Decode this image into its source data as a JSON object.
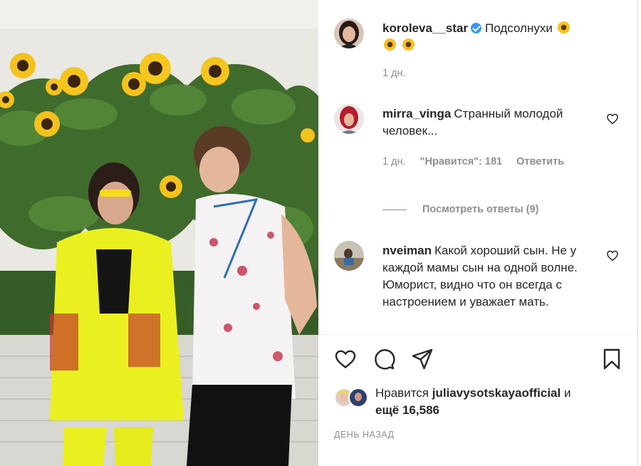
{
  "post": {
    "author": "koroleva__star",
    "caption": "Подсолнухи",
    "caption_emoji": [
      "sunflower-emoji",
      "sunflower-emoji",
      "sunflower-emoji"
    ],
    "time": "1 дн."
  },
  "comments": [
    {
      "username": "mirra_vinga",
      "text": "Странный молодой человек...",
      "time": "1 дн.",
      "likes": "\"Нравится\": 181",
      "reply": "Ответить",
      "view_replies": "Посмотреть ответы (9)"
    },
    {
      "username": "nveiman",
      "text": "Какой хороший сын. Не у каждой мамы сын на одной волне. Юморист, видно что он всегда с настроением и уважает мать."
    }
  ],
  "likes_line": {
    "prefix": "Нравится",
    "user": "juliavysotskayaofficial",
    "conj": "и",
    "count": "ещё 16,586"
  },
  "time_ago": "ДЕНЬ НАЗАД",
  "icons": [
    "heart-icon",
    "comment-icon",
    "share-icon",
    "bookmark-icon"
  ],
  "colors": {
    "verified": "#3897f0",
    "secondary_text": "#8e8e8e",
    "primary_text": "#262626"
  }
}
